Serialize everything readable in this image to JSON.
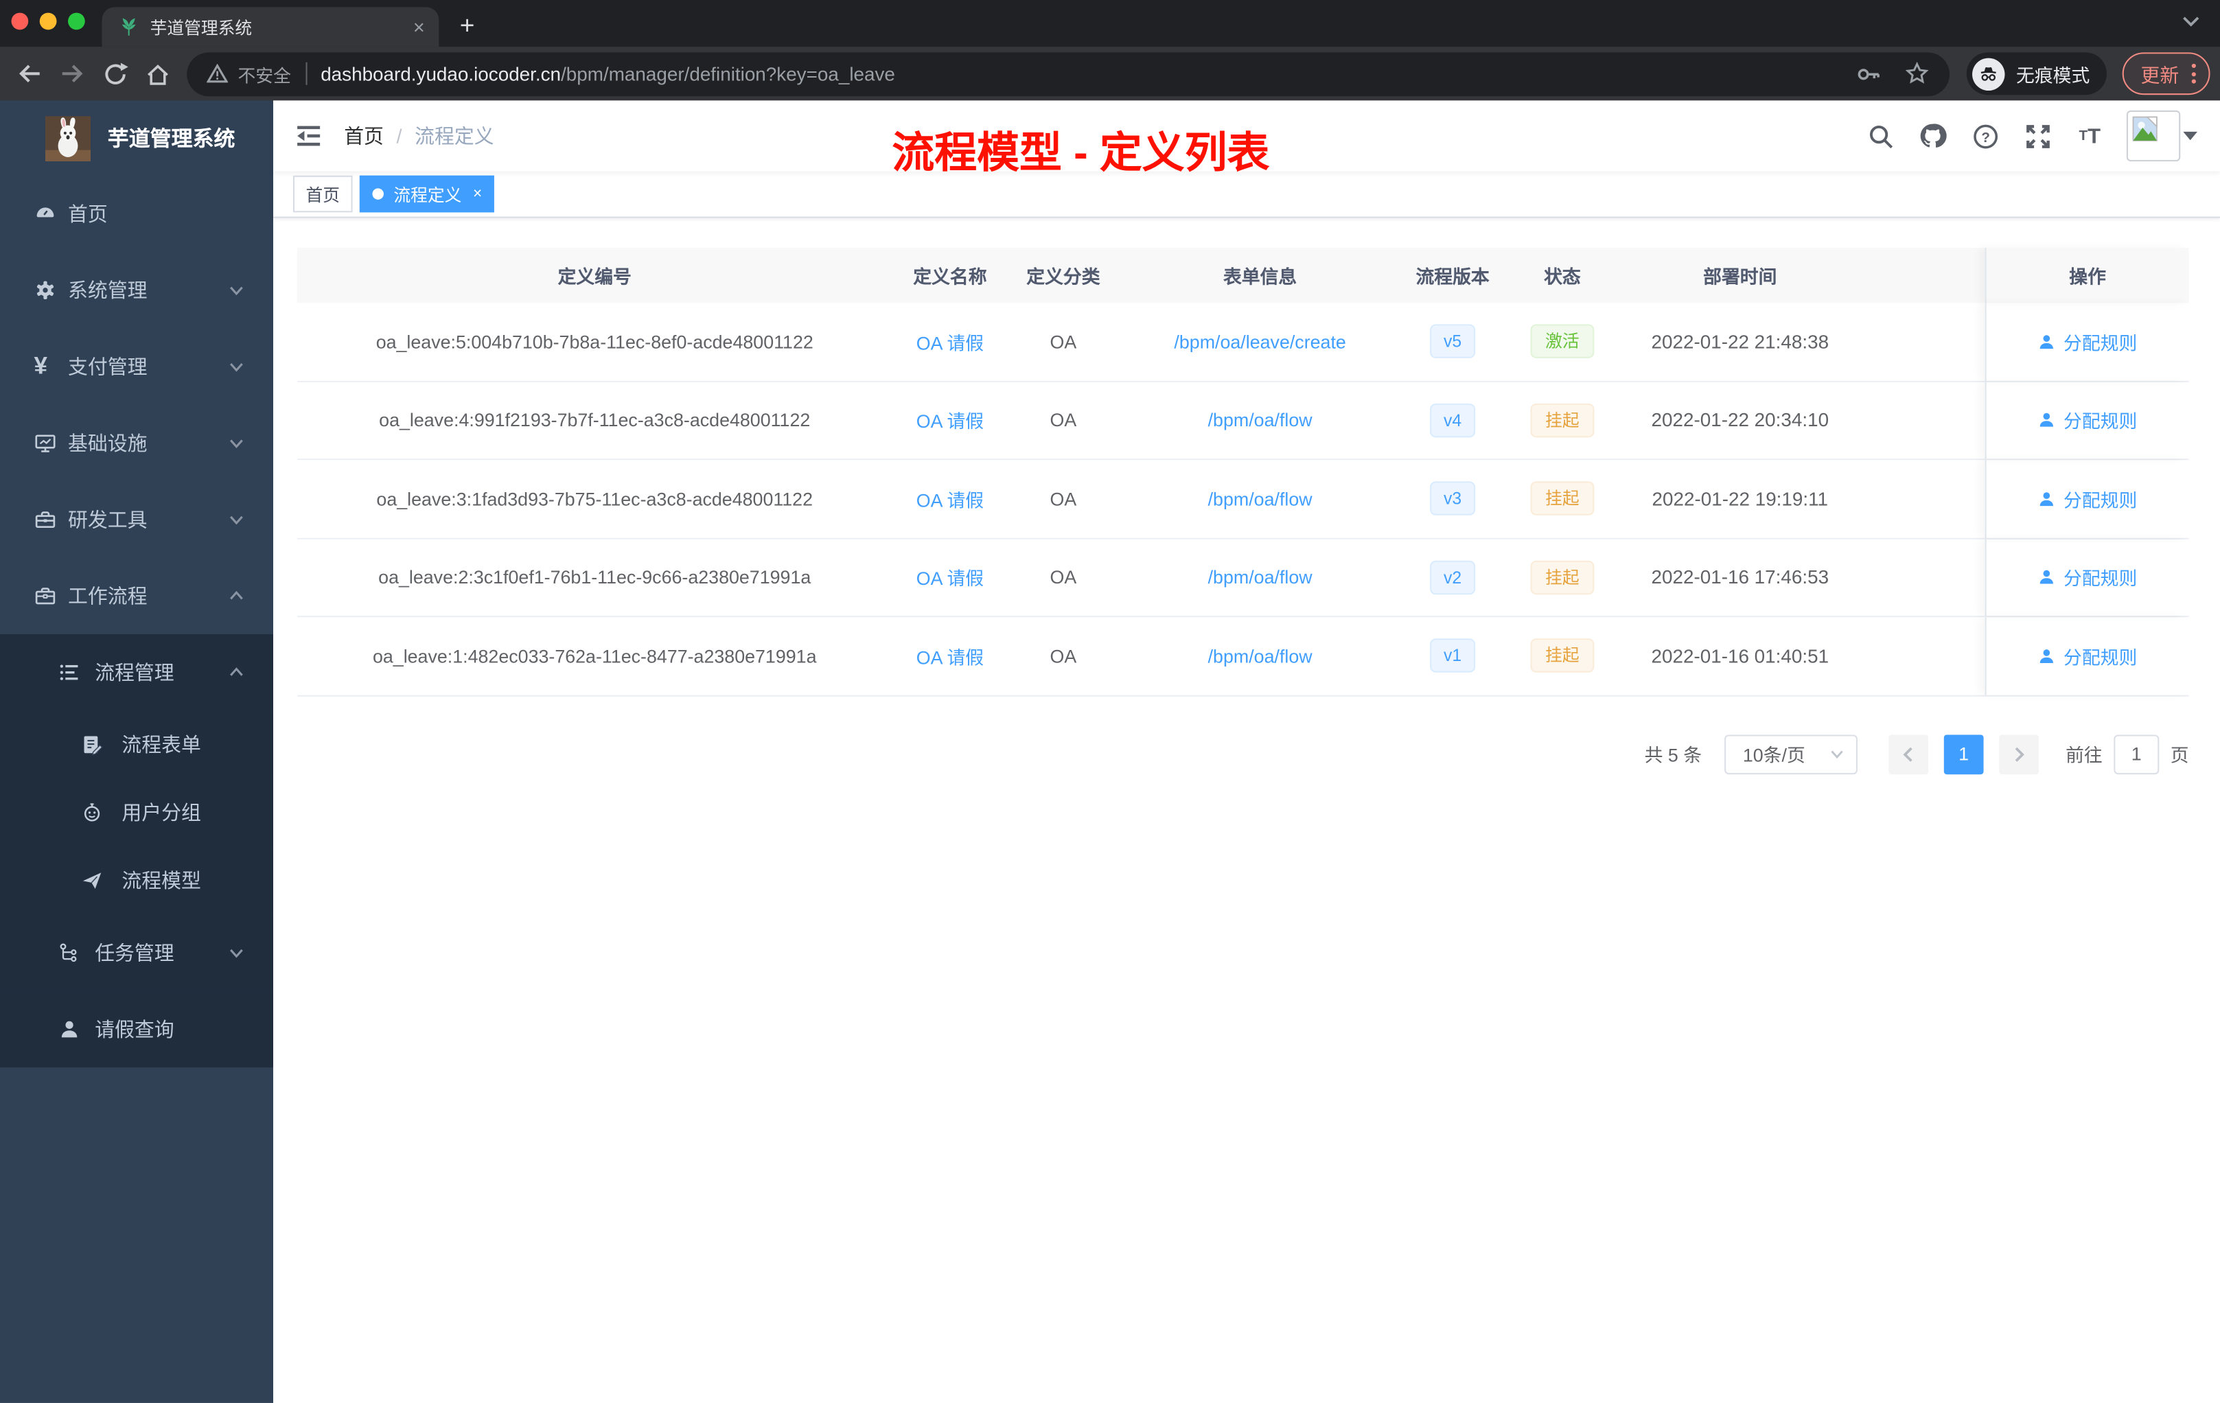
{
  "browser": {
    "tab_title": "芋道管理系统",
    "new_tab": "+",
    "close_tab": "×",
    "security_label": "不安全",
    "url_host": "dashboard.yudao.iocoder.cn",
    "url_path": "/bpm/manager/definition?key=oa_leave",
    "incognito_label": "无痕模式",
    "update_label": "更新"
  },
  "sidebar": {
    "app_title": "芋道管理系统",
    "items": [
      {
        "label": "首页",
        "icon": "dashboard-icon",
        "level": 1,
        "chevron": "none"
      },
      {
        "label": "系统管理",
        "icon": "gear-icon",
        "level": 1,
        "chevron": "down"
      },
      {
        "label": "支付管理",
        "icon": "yen-icon",
        "level": 1,
        "chevron": "down"
      },
      {
        "label": "基础设施",
        "icon": "monitor-icon",
        "level": 1,
        "chevron": "down"
      },
      {
        "label": "研发工具",
        "icon": "toolbox-icon",
        "level": 1,
        "chevron": "down"
      },
      {
        "label": "工作流程",
        "icon": "briefcase-icon",
        "level": 1,
        "chevron": "up"
      },
      {
        "label": "流程管理",
        "icon": "workflow-list-icon",
        "level": 2,
        "chevron": "up"
      },
      {
        "label": "流程表单",
        "icon": "form-icon",
        "level": 3,
        "chevron": "none"
      },
      {
        "label": "用户分组",
        "icon": "user-group-icon",
        "level": 3,
        "chevron": "none"
      },
      {
        "label": "流程模型",
        "icon": "paper-plane-icon",
        "level": 3,
        "chevron": "none"
      },
      {
        "label": "任务管理",
        "icon": "task-tree-icon",
        "level": 2,
        "chevron": "down"
      },
      {
        "label": "请假查询",
        "icon": "user-icon",
        "level": 2,
        "chevron": "none"
      }
    ]
  },
  "navbar": {
    "breadcrumb": {
      "home": "首页",
      "separator": "/",
      "current": "流程定义"
    }
  },
  "annotation": {
    "text": "流程模型 - 定义列表"
  },
  "tags": {
    "home": {
      "label": "首页",
      "active": false
    },
    "current": {
      "label": "流程定义",
      "active": true,
      "close": "×"
    }
  },
  "table": {
    "headers": [
      "定义编号",
      "定义名称",
      "定义分类",
      "表单信息",
      "流程版本",
      "状态",
      "部署时间",
      "操作"
    ],
    "action_label": "分配规则",
    "rows": [
      {
        "id": "oa_leave:5:004b710b-7b8a-11ec-8ef0-acde48001122",
        "name": "OA 请假",
        "category": "OA",
        "form": "/bpm/oa/leave/create",
        "version": "v5",
        "status": "激活",
        "status_type": "success",
        "deploy_time": "2022-01-22 21:48:38",
        "action": "分配规则"
      },
      {
        "id": "oa_leave:4:991f2193-7b7f-11ec-a3c8-acde48001122",
        "name": "OA 请假",
        "category": "OA",
        "form": "/bpm/oa/flow",
        "version": "v4",
        "status": "挂起",
        "status_type": "warning",
        "deploy_time": "2022-01-22 20:34:10",
        "action": "分配规则"
      },
      {
        "id": "oa_leave:3:1fad3d93-7b75-11ec-a3c8-acde48001122",
        "name": "OA 请假",
        "category": "OA",
        "form": "/bpm/oa/flow",
        "version": "v3",
        "status": "挂起",
        "status_type": "warning",
        "deploy_time": "2022-01-22 19:19:11",
        "action": "分配规则"
      },
      {
        "id": "oa_leave:2:3c1f0ef1-76b1-11ec-9c66-a2380e71991a",
        "name": "OA 请假",
        "category": "OA",
        "form": "/bpm/oa/flow",
        "version": "v2",
        "status": "挂起",
        "status_type": "warning",
        "deploy_time": "2022-01-16 17:46:53",
        "action": "分配规则"
      },
      {
        "id": "oa_leave:1:482ec033-762a-11ec-8477-a2380e71991a",
        "name": "OA 请假",
        "category": "OA",
        "form": "/bpm/oa/flow",
        "version": "v1",
        "status": "挂起",
        "status_type": "warning",
        "deploy_time": "2022-01-16 01:40:51",
        "action": "分配规则"
      }
    ]
  },
  "pagination": {
    "total_label": "共 5 条",
    "page_size_label": "10条/页",
    "prev": "‹",
    "current_page": "1",
    "next": "›",
    "goto_label": "前往",
    "goto_value": "1",
    "page_unit_label": "页"
  },
  "colors": {
    "accent_blue": "#409eff",
    "sidebar_bg": "#304156",
    "submenu_bg": "#1f2d3d",
    "sidebar_text": "#bfcbd9",
    "chrome_dark": "#202124",
    "chrome_toolbar": "#35363a",
    "annotation_red": "#fe1100",
    "update_red": "#f28b82",
    "tag_success_text": "#67c23a",
    "tag_warning_text": "#e6a23c",
    "table_header_bg": "#f8f8f9",
    "table_border": "#ebeef5"
  },
  "icons": {
    "list": [
      "plant-favicon",
      "back-icon",
      "forward-icon",
      "reload-icon",
      "home-icon",
      "warning-icon",
      "key-icon",
      "star-icon",
      "incognito-icon",
      "menu-dots-icon",
      "fold-icon",
      "search-icon",
      "github-icon",
      "question-icon",
      "fullscreen-icon",
      "font-size-icon",
      "broken-image-avatar",
      "caret-down-icon",
      "user-icon"
    ]
  }
}
